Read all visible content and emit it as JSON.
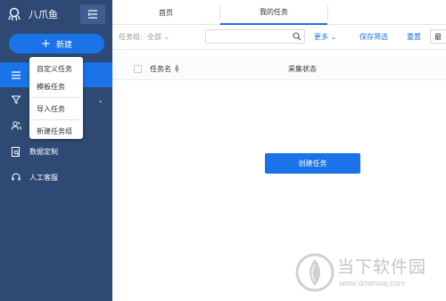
{
  "app": {
    "brand": "八爪鱼"
  },
  "sidebar": {
    "new_button": "新建",
    "items": [
      {
        "label": "",
        "icon": "list-icon"
      },
      {
        "label": "",
        "icon": "filter-icon"
      },
      {
        "label": "",
        "icon": "users-icon"
      },
      {
        "label": "数据定制",
        "icon": "data-icon"
      },
      {
        "label": "人工客服",
        "icon": "headset-icon"
      }
    ]
  },
  "dropdown": {
    "items": [
      "自定义任务",
      "模板任务",
      "导入任务",
      "新建任务组"
    ]
  },
  "tabs": [
    {
      "label": "首页"
    },
    {
      "label": "我的任务"
    }
  ],
  "toolbar": {
    "group_label": "任务组:",
    "group_value": "全部",
    "search_placeholder": "",
    "more": "更多",
    "save_filter": "保存筛选",
    "reset": "重置",
    "extra": "最"
  },
  "table": {
    "columns": [
      "任务名",
      "采集状态"
    ]
  },
  "main": {
    "create_button": "创建任务"
  },
  "watermark": {
    "text": "当下软件园",
    "url": "www.downxia.com"
  },
  "colors": {
    "sidebar": "#2e4a74",
    "accent": "#1a73e8"
  }
}
